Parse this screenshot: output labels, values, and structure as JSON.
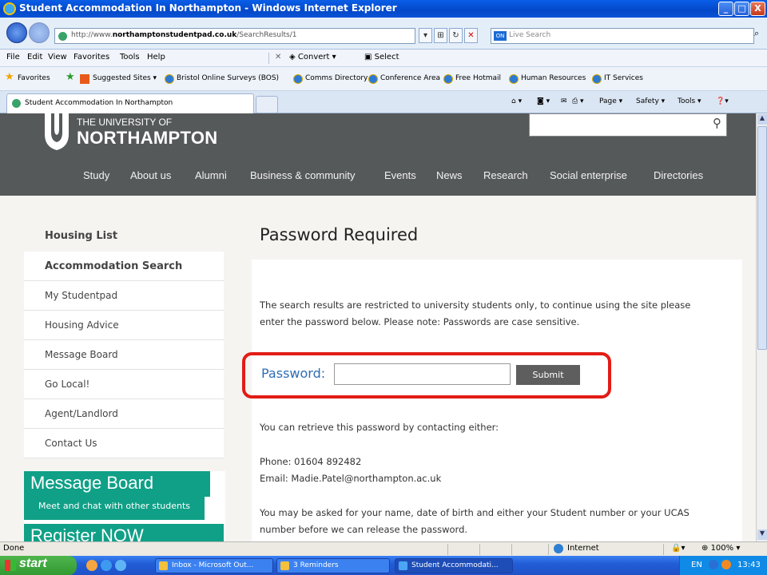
{
  "window": {
    "title": "Student Accommodation In Northampton - Windows Internet Explorer",
    "minimize": "_",
    "maximize": "□",
    "close": "X"
  },
  "address_bar": {
    "url_prefix": "http://www.",
    "url_domain": "northamptonstudentpad.co.uk",
    "url_path": "/SearchResults/1",
    "live_search_placeholder": "Live Search"
  },
  "menu": [
    "File",
    "Edit",
    "View",
    "Favorites",
    "Tools",
    "Help"
  ],
  "toolbar": {
    "convert": "Convert",
    "select": "Select"
  },
  "favorites_bar": {
    "favorites": "Favorites",
    "links": [
      "Suggested Sites ▾",
      "Bristol Online Surveys (BOS)",
      "Comms Directory",
      "Conference Area",
      "Free Hotmail",
      "Human Resources",
      "IT Services"
    ]
  },
  "tab": {
    "label": "Student Accommodation In Northampton"
  },
  "tab_tools": {
    "page": "Page ▾",
    "safety": "Safety ▾",
    "tools": "Tools ▾"
  },
  "site": {
    "logo_line1": "THE UNIVERSITY OF",
    "logo_line2": "NORTHAMPTON",
    "nav": [
      "Study",
      "About us",
      "Alumni",
      "Business & community",
      "Events",
      "News",
      "Research",
      "Social enterprise",
      "Directories"
    ]
  },
  "sidebar": {
    "heading": "Housing List",
    "items": [
      "Accommodation Search",
      "My Studentpad",
      "Housing Advice",
      "Message Board",
      "Go Local!",
      "Agent/Landlord",
      "Contact Us"
    ]
  },
  "message_board": {
    "title": "Message Board",
    "subtitle": "Meet and chat with other students",
    "register": "Register NOW"
  },
  "main": {
    "title": "Password Required",
    "intro_line1": "The search results are restricted to university students only, to continue using the site please",
    "intro_line2": "enter the password below. Please note: Passwords are case sensitive.",
    "password_label": "Password:",
    "submit_label": "Submit",
    "retrieve": "You can retrieve this password by contacting either:",
    "phone": "Phone: 01604 892482",
    "email": "Email: Madie.Patel@northampton.ac.uk",
    "note_line1": "You may be asked for your name, date of birth and either your Student number or your UCAS",
    "note_line2": "number before we can release the password."
  },
  "status_bar": {
    "status": "Done",
    "zone": "Internet",
    "zoom": "100%"
  },
  "taskbar": {
    "start": "start",
    "tasks": [
      "Inbox - Microsoft Out...",
      "3 Reminders",
      "Student Accommodati..."
    ],
    "lang": "EN",
    "time": "13:43"
  }
}
